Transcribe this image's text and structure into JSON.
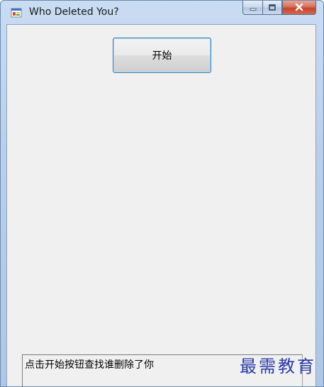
{
  "window": {
    "title": "Who Deleted You?",
    "icon": "app-window-icon"
  },
  "caption": {
    "minimize_icon": "minimize-icon",
    "maximize_icon": "maximize-icon",
    "close_icon": "close-icon"
  },
  "main": {
    "start_button_label": "开始",
    "status_text": "点击开始按钮查找谁删除了你"
  },
  "watermark": {
    "text": "最需教育"
  },
  "colors": {
    "accent_border": "#3c7fb1",
    "close_button": "#c7432a",
    "watermark": "#2b3aa8"
  }
}
